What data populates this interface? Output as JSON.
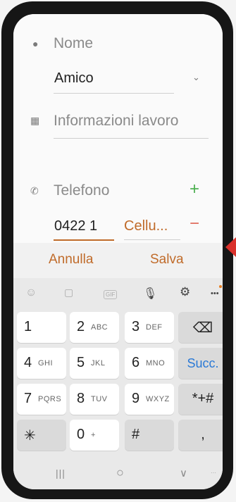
{
  "form": {
    "name_label": "Nome",
    "name_value": "Amico",
    "work_label": "Informazioni lavoro",
    "phone_label": "Telefono",
    "phone_value": "0422 1",
    "phone_type": "Cellu...",
    "add_symbol": "+",
    "remove_symbol": "−"
  },
  "actions": {
    "cancel": "Annulla",
    "save": "Salva"
  },
  "keyboard": {
    "toolbar": {
      "more": "•••",
      "gif": "GIF"
    },
    "rows": [
      [
        {
          "digit": "1",
          "letters": ""
        },
        {
          "digit": "2",
          "letters": "ABC"
        },
        {
          "digit": "3",
          "letters": "DEF"
        },
        {
          "digit": "⌫",
          "letters": ""
        }
      ],
      [
        {
          "digit": "4",
          "letters": "GHI"
        },
        {
          "digit": "5",
          "letters": "JKL"
        },
        {
          "digit": "6",
          "letters": "MNO"
        },
        {
          "digit": "Succ.",
          "letters": ""
        }
      ],
      [
        {
          "digit": "7",
          "letters": "PQRS"
        },
        {
          "digit": "8",
          "letters": "TUV"
        },
        {
          "digit": "9",
          "letters": "WXYZ"
        },
        {
          "digit": "*+#",
          "letters": ""
        }
      ],
      [
        {
          "digit": "✳",
          "letters": ""
        },
        {
          "digit": "0",
          "letters": "+"
        },
        {
          "digit": "#",
          "letters": ""
        },
        {
          "digit": ",",
          "letters": ""
        }
      ]
    ]
  },
  "navbar": {
    "recents": "|||",
    "home": "○",
    "back": "∨"
  },
  "colors": {
    "accent": "#c06b2a",
    "add_green": "#4caf50",
    "remove_red": "#e06a5a",
    "next_blue": "#2a79d6",
    "arrow_red": "#d9312b"
  }
}
